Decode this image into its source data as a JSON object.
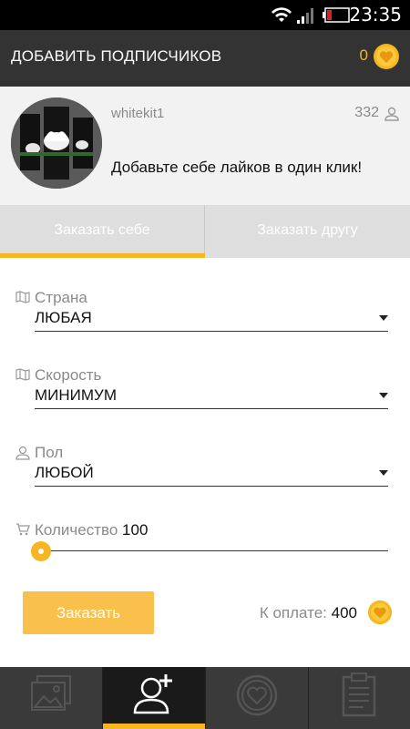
{
  "status_bar": {
    "time": "23:35"
  },
  "app_bar": {
    "title": "ДОБАВИТЬ ПОДПИСЧИКОВ",
    "coins": "0"
  },
  "profile": {
    "username": "whitekit1",
    "followers": "332",
    "promo_text": "Добавьте себе лайков в один клик!"
  },
  "tabs": [
    {
      "label": "Заказать себе",
      "active": true
    },
    {
      "label": "Заказать другу",
      "active": false
    }
  ],
  "form": {
    "country": {
      "label": "Страна",
      "value": "ЛЮБАЯ"
    },
    "speed": {
      "label": "Скорость",
      "value": "МИНИМУМ"
    },
    "gender": {
      "label": "Пол",
      "value": "ЛЮБОЙ"
    },
    "quantity": {
      "label": "Количество",
      "value": "100",
      "slider_fraction": 0.0
    }
  },
  "order_button": "Заказать",
  "payment": {
    "label": "К оплате:",
    "value": "400"
  },
  "bottom_nav": [
    {
      "icon": "gallery-icon",
      "active": false
    },
    {
      "icon": "add-user-icon",
      "active": true
    },
    {
      "icon": "heart-icon",
      "active": false
    },
    {
      "icon": "clipboard-icon",
      "active": false
    }
  ],
  "colors": {
    "accent": "#f7b521",
    "app_bar": "#333333",
    "tab_bg": "#dedede",
    "button": "#f9c14c"
  }
}
